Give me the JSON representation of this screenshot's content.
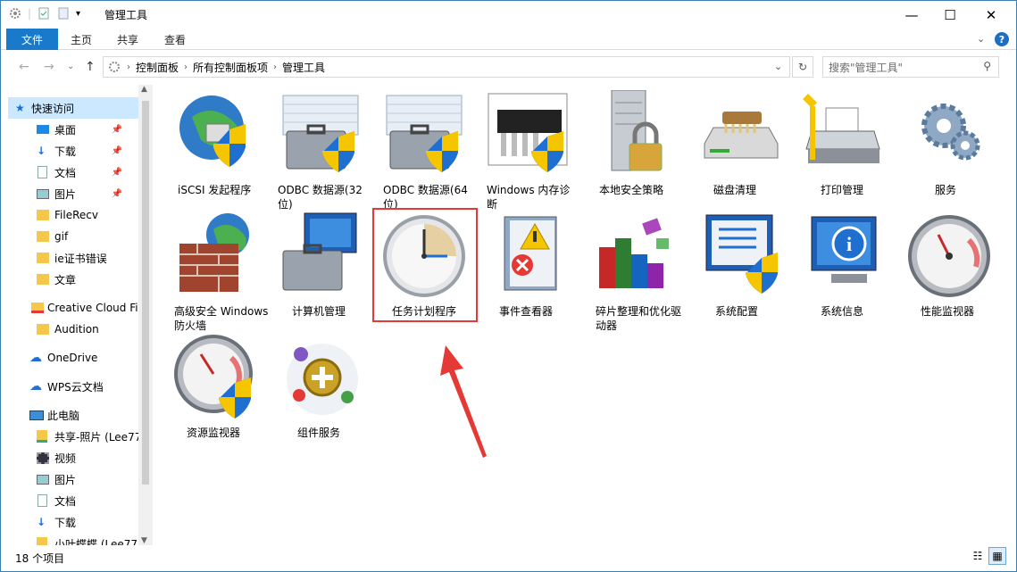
{
  "window": {
    "title": "管理工具",
    "minimize": "—",
    "maximize": "☐",
    "close": "✕"
  },
  "ribbon": {
    "tabs": [
      "文件",
      "主页",
      "共享",
      "查看"
    ],
    "help": "?"
  },
  "breadcrumb": [
    "控制面板",
    "所有控制面板项",
    "管理工具"
  ],
  "search": {
    "placeholder": "搜索\"管理工具\""
  },
  "nav": {
    "quick_access": "快速访问",
    "items": [
      {
        "label": "桌面",
        "pinned": true
      },
      {
        "label": "下载",
        "pinned": true
      },
      {
        "label": "文档",
        "pinned": true
      },
      {
        "label": "图片",
        "pinned": true
      },
      {
        "label": "FileRecv"
      },
      {
        "label": "gif"
      },
      {
        "label": "ie证书错误"
      },
      {
        "label": "文章"
      }
    ],
    "creative_cloud": "Creative Cloud Fil",
    "audition": "Audition",
    "onedrive": "OneDrive",
    "wps": "WPS云文档",
    "this_pc": "此电脑",
    "pc_items": [
      "共享-照片 (Lee77",
      "视频",
      "图片",
      "文档",
      "下载",
      "小叶蝶蝶 (Lee77"
    ]
  },
  "icons": [
    {
      "label": "iSCSI 发起程序"
    },
    {
      "label": "ODBC 数据源(32位)"
    },
    {
      "label": "ODBC 数据源(64位)"
    },
    {
      "label": "Windows 内存诊断"
    },
    {
      "label": "本地安全策略"
    },
    {
      "label": "磁盘清理"
    },
    {
      "label": "打印管理"
    },
    {
      "label": "服务"
    },
    {
      "label": "高级安全 Windows 防火墙"
    },
    {
      "label": "计算机管理"
    },
    {
      "label": "任务计划程序"
    },
    {
      "label": "事件查看器"
    },
    {
      "label": "碎片整理和优化驱动器"
    },
    {
      "label": "系统配置"
    },
    {
      "label": "系统信息"
    },
    {
      "label": "性能监视器"
    },
    {
      "label": "资源监视器"
    },
    {
      "label": "组件服务"
    }
  ],
  "status": {
    "count": "18 个项目"
  },
  "colors": {
    "accent": "#1979ca",
    "highlight": "#e53935"
  }
}
